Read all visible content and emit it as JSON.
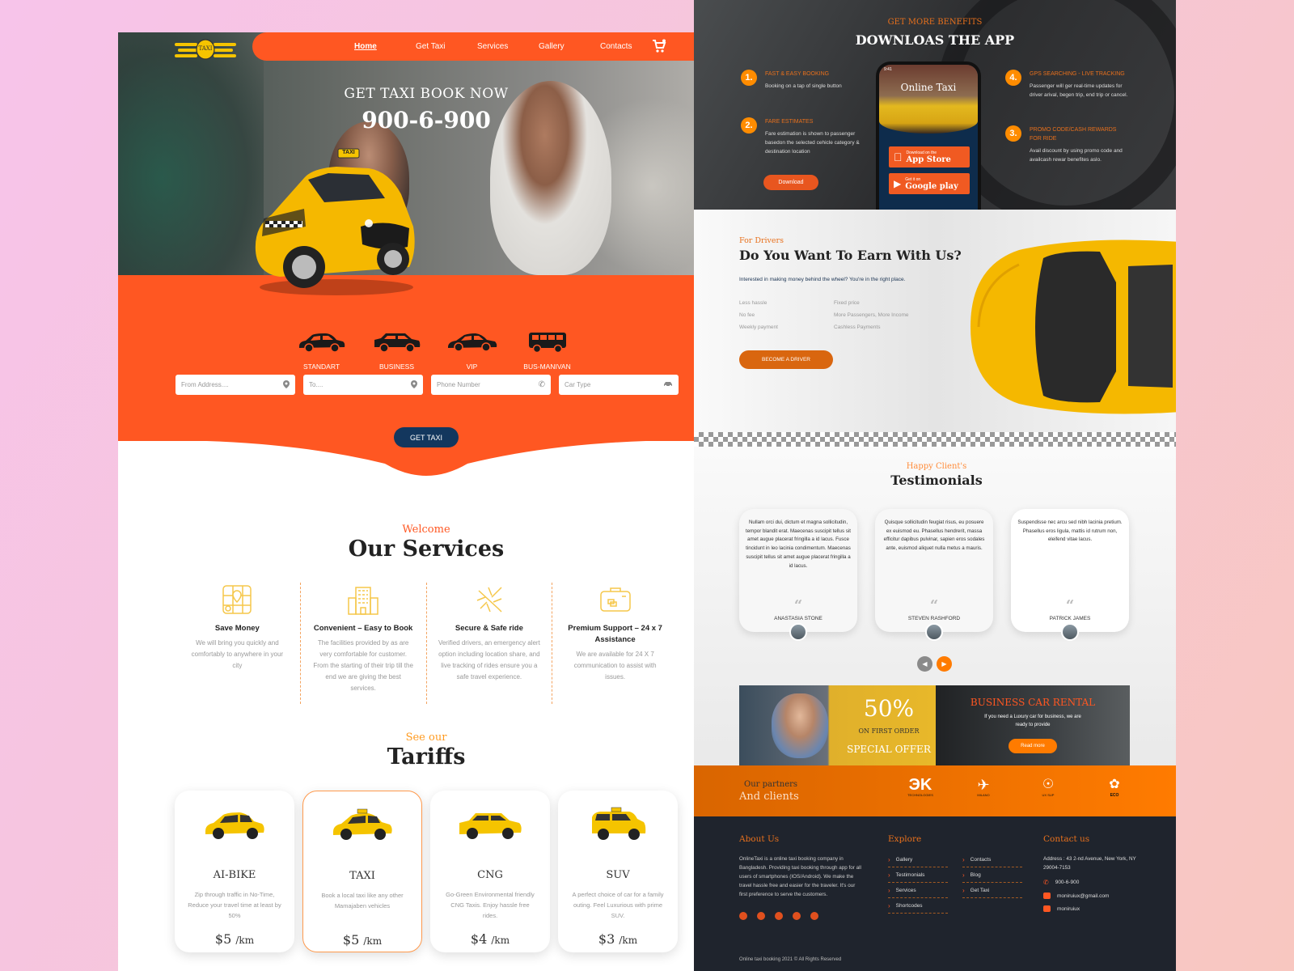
{
  "left": {
    "nav": {
      "logo_text": "TAXI",
      "items": [
        {
          "label": "Home",
          "active": true
        },
        {
          "label": "Get Taxi"
        },
        {
          "label": "Services"
        },
        {
          "label": "Gallery"
        },
        {
          "label": "Contacts"
        }
      ],
      "cart_icon": "cart-icon"
    },
    "hero": {
      "title": "GET TAXI BOOK NOW",
      "phone": "900-6-900",
      "car_sign": "TAXI"
    },
    "booking": {
      "car_types": [
        {
          "label": "STANDART",
          "icon": "sedan-icon"
        },
        {
          "label": "BUSINESS",
          "icon": "suv-icon"
        },
        {
          "label": "VIP",
          "icon": "coupe-icon"
        },
        {
          "label": "BUS-MANIVAN",
          "icon": "bus-icon"
        }
      ],
      "fields": [
        {
          "placeholder": "From Address....",
          "icon": "map-pin-icon"
        },
        {
          "placeholder": "To....",
          "icon": "map-pin-icon"
        },
        {
          "placeholder": "Phone Number",
          "icon": "phone-icon"
        },
        {
          "placeholder": "Car Type",
          "icon": "car-icon"
        }
      ],
      "submit_label": "GET TAXI"
    },
    "services": {
      "subtitle": "Welcome",
      "title": "Our Services",
      "items": [
        {
          "title": "Save Money",
          "desc": "We will bring you quickly and comfortably to anywhere in your city",
          "icon": "city-map-icon"
        },
        {
          "title": "Convenient – Easy to Book",
          "desc": "The facilities provided by as are very comfortable for customer. From the starting of their trip till the end we are giving the best services.",
          "icon": "building-icon"
        },
        {
          "title": "Secure & Safe ride",
          "desc": "Verified drivers, an emergency alert option including location share, and live tracking of rides ensure you a safe travel experience.",
          "icon": "airplane-icon"
        },
        {
          "title": "Premium Support – 24 x 7 Assistance",
          "desc": "We are available for 24 X 7 communication to assist with issues.",
          "icon": "suitcase-icon"
        }
      ]
    },
    "tariffs": {
      "subtitle": "See our",
      "title": "Tariffs",
      "items": [
        {
          "name": "AI-BIKE",
          "desc": "Zip through traffic in No-Time, Reduce your travel time at least by 50%",
          "price": "$5",
          "unit": "/km"
        },
        {
          "name": "TAXI",
          "desc": "Book a local taxi like any other Mamajaben vehicles",
          "price": "$5",
          "unit": "/km",
          "selected": true
        },
        {
          "name": "CNG",
          "desc": "Go-Green Environmental friendly CNG Taxis. Enjoy hassle free rides.",
          "price": "$4",
          "unit": "/km"
        },
        {
          "name": "SUV",
          "desc": "A perfect choice of car for a family outing. Feel Luxurious with prime SUV.",
          "price": "$3",
          "unit": "/km"
        }
      ]
    }
  },
  "right": {
    "app": {
      "subtitle": "GET MORE BENEFITS",
      "title": "DOWNLOAS THE APP",
      "features": [
        {
          "num": "1.",
          "title": "FAST & EASY BOOKING",
          "desc": "Booking on a tap of single button"
        },
        {
          "num": "2.",
          "title": "FARE ESTIMATES",
          "desc": "Fare estimation is shown to passenger basedon the selected cehicle category & destination location"
        },
        {
          "num": "3.",
          "title": "PROMO CODE/CASH REWARDS FOR RIDE",
          "desc": "Avail discount by using promo code and availcash rewar benefites aslo."
        },
        {
          "num": "4.",
          "title": "GPS SEARCHING - LIVE TRACKING",
          "desc": "Passenger will ger real-time updates for driver arival, begen trip, end trip or cancel."
        }
      ],
      "download_label": "Download",
      "phone": {
        "time": "9:41",
        "screen_title": "Online Taxi",
        "app_store": {
          "small": "Download on the",
          "big": "App Store"
        },
        "google_play": {
          "small": "Get it on",
          "big": "Google play"
        }
      }
    },
    "drivers": {
      "subtitle": "For Drivers",
      "title": "Do You Want To Earn With Us?",
      "desc": "Interested in making money behind the wheel? You're in the right place.",
      "list_left": [
        "Less hassle",
        "No fee",
        "Weekly payment"
      ],
      "list_right": [
        "Fixed price",
        "More Passengers, More Income",
        "Cashless Payments"
      ],
      "button": "BECOME A DRIVER"
    },
    "testimonials": {
      "subtitle": "Happy Client's",
      "title": "Testimonials",
      "items": [
        {
          "quote": "Nullam orci dui, dictum et magna sollicitudin, tempor blandit erat. Maecenas suscipit tellus sit amet augue placerat fringilla a id lacus. Fusce tincidunt in leo lacinia condimentum. Maecenas suscipit tellus sit amet augue placerat fringilla a id lacus.",
          "name": "ANASTASIA STONE"
        },
        {
          "quote": "Quisque sollicitudin feugiat risus, eu posuere ex euismod eu. Phasellus hendrerit, massa efficitur dapibus pulvinar, sapien eros sodales ante, euismod aliquet nulla metus a mauris.",
          "name": "STEVEN RASHFORD"
        },
        {
          "quote": "Suspendisse nec arcu sed nibh lacinia pretium. Phasellus eros ligula, mattis id rutrum non, eleifend vitae lacus.",
          "name": "PATRICK JAMES"
        }
      ],
      "prev_icon": "chevron-left-icon",
      "next_icon": "chevron-right-icon"
    },
    "promo": {
      "percent": "50%",
      "line1": "ON FIRST ORDER",
      "line2": "SPECIAL OFFER",
      "rental_title": "BUSINESS CAR RENTAL",
      "rental_desc": "If you need a Luxury car for business, we are ready to provide",
      "rental_button": "Read more"
    },
    "partners": {
      "line1": "Our partners",
      "line2": "And clients",
      "logos": [
        {
          "name": "DK",
          "caption": "TECHNOLOGIES"
        },
        {
          "name": "MILANO",
          "caption": "AIRPORT"
        },
        {
          "name": "UX SUP",
          "caption": "UX SUP"
        },
        {
          "name": "ECO",
          "caption": "ECO"
        }
      ]
    },
    "footer": {
      "about_title": "About Us",
      "about_text": "OnlineTaxi is a online taxi booking company in Bangladesh. Providing taxi booking through app for all users of smartphones (IOS/Android). We make the travel hassle free and easier for the traveler. It's our first preference to serve the customers.",
      "social": [
        "google-plus-icon",
        "twitter-icon",
        "pinterest-icon",
        "facebook-icon",
        "skype-icon"
      ],
      "explore_title": "Explore",
      "explore_col1": [
        "Gallery",
        "Testimonials",
        "Services",
        "Shortcodes"
      ],
      "explore_col2": [
        "Contacts",
        "Blog",
        "Get Taxi"
      ],
      "contact_title": "Contact us",
      "address": "Address : 43 2-nd Avenue, New York, NY 29004-7153",
      "phone": "900-6-900",
      "email": "moniruiux@gmail.com",
      "skype": "moniruiux",
      "copyright": "Online taxi booking 2021 © All Rights Reserved"
    }
  },
  "colors": {
    "accent": "#ff5722",
    "orange": "#ff8c00",
    "navy": "#13375e",
    "dark": "#1f242d",
    "yellow": "#f5c400"
  }
}
